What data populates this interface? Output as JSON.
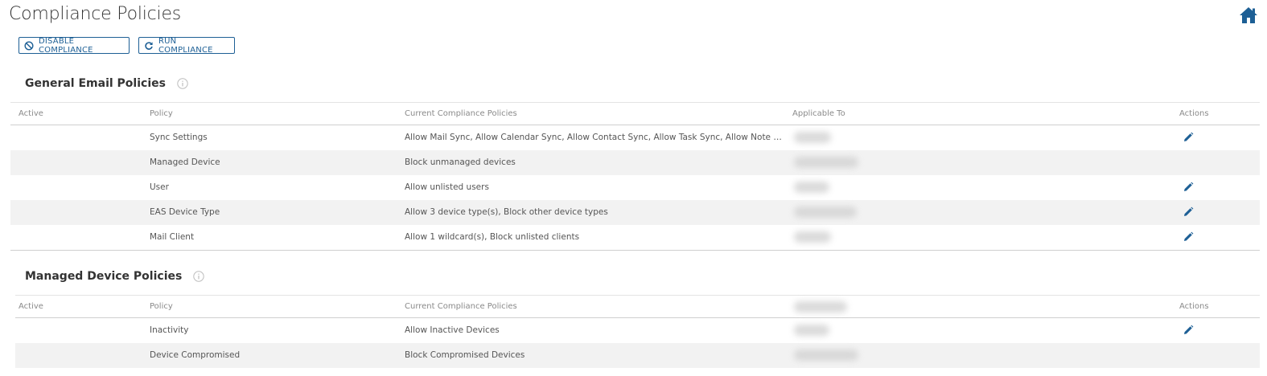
{
  "page": {
    "title": "Compliance Policies"
  },
  "toolbar": {
    "disable_label": "DISABLE COMPLIANCE",
    "run_label": "RUN COMPLIANCE"
  },
  "columns": {
    "active": "Active",
    "policy": "Policy",
    "current": "Current Compliance Policies",
    "applicable": "Applicable To",
    "actions": "Actions"
  },
  "general": {
    "title": "General Email Policies",
    "rows": [
      {
        "policy": "Sync Settings",
        "current": "Allow Mail Sync, Allow Calendar Sync, Allow Contact Sync, Allow Task Sync, Allow Note Sync, Allow Attachments",
        "editable": true
      },
      {
        "policy": "Managed Device",
        "current": "Block unmanaged devices",
        "editable": false
      },
      {
        "policy": "User",
        "current": "Allow unlisted users",
        "editable": true
      },
      {
        "policy": "EAS Device Type",
        "current": "Allow 3 device type(s), Block other device types",
        "editable": true
      },
      {
        "policy": "Mail Client",
        "current": "Allow 1 wildcard(s), Block unlisted clients",
        "editable": true
      }
    ]
  },
  "managed": {
    "title": "Managed Device Policies",
    "rows": [
      {
        "policy": "Inactivity",
        "current": "Allow Inactive Devices",
        "editable": true
      },
      {
        "policy": "Device Compromised",
        "current": "Block Compromised Devices",
        "editable": false
      }
    ]
  },
  "colors": {
    "accent": "#1d5f95",
    "stripe": "#f2f2f2",
    "text": "#555555"
  },
  "icons": {
    "home": "home-icon",
    "disable": "ban-icon",
    "run": "refresh-icon",
    "info": "info-icon",
    "edit": "pencil-icon"
  }
}
